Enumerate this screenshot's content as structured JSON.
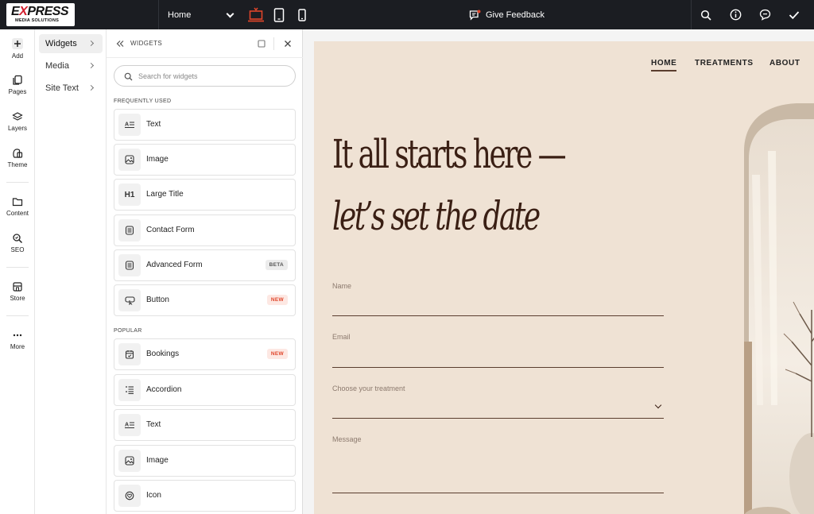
{
  "topbar": {
    "logo": {
      "brand_pre": "E",
      "brand_x": "X",
      "brand_post": "PRESS",
      "sub": "MEDIA SOLUTIONS"
    },
    "page_select": "Home",
    "device_icons": [
      "desktop-icon",
      "tablet-icon",
      "mobile-icon"
    ],
    "feedback_label": "Give Feedback",
    "right_icons": [
      "search-icon",
      "info-icon",
      "chat-icon",
      "check-icon"
    ],
    "accent_color": "#e0452a"
  },
  "rail": {
    "items": [
      {
        "label": "Add",
        "icon": "plus-icon"
      },
      {
        "label": "Pages",
        "icon": "pages-icon"
      },
      {
        "label": "Layers",
        "icon": "layers-icon"
      },
      {
        "label": "Theme",
        "icon": "theme-icon"
      },
      {
        "label": "Content",
        "icon": "folder-icon"
      },
      {
        "label": "SEO",
        "icon": "seo-icon"
      },
      {
        "label": "Store",
        "icon": "store-icon"
      },
      {
        "label": "More",
        "icon": "more-icon"
      }
    ]
  },
  "col2": {
    "items": [
      {
        "label": "Widgets",
        "active": true
      },
      {
        "label": "Media",
        "active": false
      },
      {
        "label": "Site Text",
        "active": false
      }
    ]
  },
  "panel": {
    "title": "WIDGETS",
    "search_placeholder": "Search for widgets",
    "frequently_used_label": "FREQUENTLY USED",
    "popular_label": "POPULAR",
    "frequently_used": [
      {
        "label": "Text",
        "icon": "text-icon",
        "badge": ""
      },
      {
        "label": "Image",
        "icon": "image-icon",
        "badge": ""
      },
      {
        "label": "Large Title",
        "icon": "heading-icon",
        "badge": ""
      },
      {
        "label": "Contact Form",
        "icon": "form-icon",
        "badge": ""
      },
      {
        "label": "Advanced Form",
        "icon": "advanced-form-icon",
        "badge": "BETA"
      },
      {
        "label": "Button",
        "icon": "button-icon",
        "badge": "NEW"
      }
    ],
    "popular": [
      {
        "label": "Bookings",
        "icon": "calendar-icon",
        "badge": "NEW"
      },
      {
        "label": "Accordion",
        "icon": "accordion-icon",
        "badge": ""
      },
      {
        "label": "Text",
        "icon": "text-icon",
        "badge": ""
      },
      {
        "label": "Image",
        "icon": "image-icon",
        "badge": ""
      },
      {
        "label": "Icon",
        "icon": "icon-widget-icon",
        "badge": ""
      }
    ],
    "heading_glyph": "H1"
  },
  "preview": {
    "nav": [
      "HOME",
      "TREATMENTS",
      "ABOUT"
    ],
    "hero_line1": "It all starts here —",
    "hero_line2": "let’s set the date",
    "fields": [
      "Name",
      "Email",
      "Choose your treatment",
      "Message"
    ],
    "bg_color": "#efe2d4",
    "text_color": "#3a1f14"
  }
}
